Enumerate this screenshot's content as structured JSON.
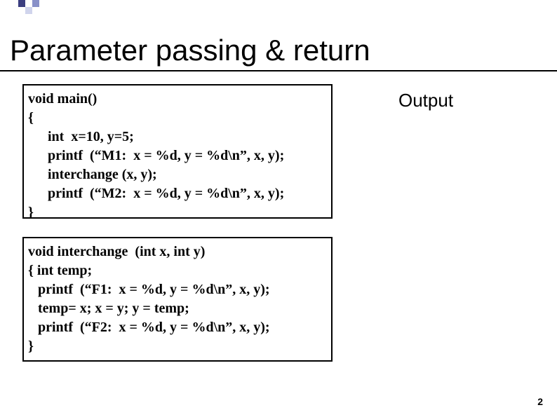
{
  "slide": {
    "title": "Parameter passing & return",
    "output_label": "Output",
    "page_number": "2"
  },
  "code1": {
    "l1": "void main()",
    "l2": "{",
    "l3": "int  x=10, y=5;",
    "l4": "printf  (“M1:  x = %d, y = %d\\n”, x, y);",
    "l5": "interchange (x, y);",
    "l6": "printf  (“M2:  x = %d, y = %d\\n”, x, y);",
    "l7": "}"
  },
  "code2": {
    "l1": "void interchange  (int x, int y)",
    "l2": "{ int temp;",
    "l3": "printf  (“F1:  x = %d, y = %d\\n”, x, y);",
    "l4": "temp= x; x = y; y = temp;",
    "l5": "printf  (“F2:  x = %d, y = %d\\n”, x, y);",
    "l6": "}"
  }
}
